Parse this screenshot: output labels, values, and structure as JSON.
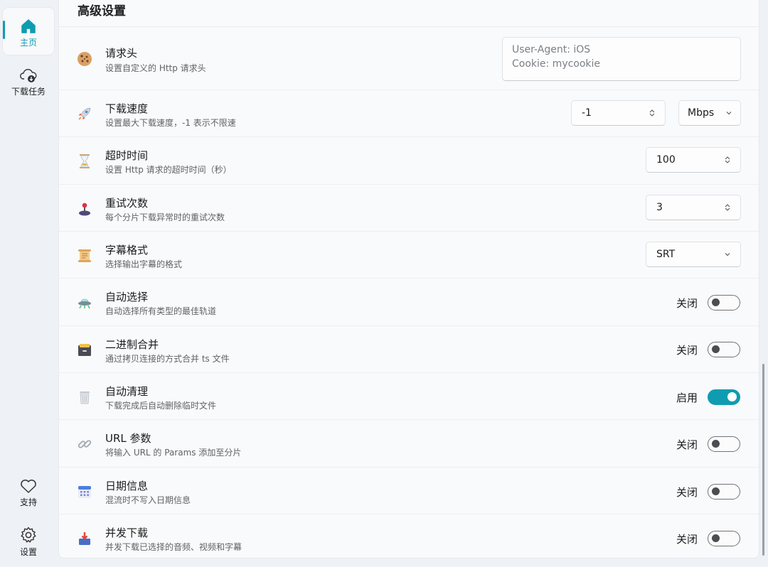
{
  "sidebar": {
    "items": [
      {
        "label": "主页",
        "icon": "home-icon",
        "active": true
      },
      {
        "label": "下载任务",
        "icon": "cloud-download-icon",
        "active": false
      }
    ],
    "bottom_items": [
      {
        "label": "支持",
        "icon": "heart-icon"
      },
      {
        "label": "设置",
        "icon": "gear-icon"
      }
    ]
  },
  "section": {
    "title": "高级设置"
  },
  "rows": {
    "headers": {
      "title": "请求头",
      "desc": "设置自定义的 Http 请求头",
      "icon": "cookie-icon",
      "value_line1": "User-Agent: iOS",
      "value_line2": "Cookie: mycookie"
    },
    "speed": {
      "title": "下载速度",
      "desc": "设置最大下载速度，-1 表示不限速",
      "icon": "rocket-icon",
      "value": "-1",
      "unit": "Mbps"
    },
    "timeout": {
      "title": "超时时间",
      "desc": "设置 Http 请求的超时时间（秒）",
      "icon": "hourglass-icon",
      "value": "100"
    },
    "retry": {
      "title": "重试次数",
      "desc": "每个分片下载异常时的重试次数",
      "icon": "joystick-icon",
      "value": "3"
    },
    "subtitle_format": {
      "title": "字幕格式",
      "desc": "选择输出字幕的格式",
      "icon": "scroll-icon",
      "value": "SRT"
    },
    "auto_select": {
      "title": "自动选择",
      "desc": "自动选择所有类型的最佳轨道",
      "icon": "ufo-icon",
      "state_label": "关闭",
      "on": false
    },
    "binary_merge": {
      "title": "二进制合并",
      "desc": "通过拷贝连接的方式合并 ts 文件",
      "icon": "cabinet-icon",
      "state_label": "关闭",
      "on": false
    },
    "auto_clean": {
      "title": "自动清理",
      "desc": "下载完成后自动删除临时文件",
      "icon": "trash-icon",
      "state_label": "启用",
      "on": true
    },
    "url_params": {
      "title": "URL 参数",
      "desc": "将输入 URL 的 Params 添加至分片",
      "icon": "link-icon",
      "state_label": "关闭",
      "on": false
    },
    "date_info": {
      "title": "日期信息",
      "desc": "混流时不写入日期信息",
      "icon": "calendar-icon",
      "state_label": "关闭",
      "on": false
    },
    "concurrent": {
      "title": "并发下载",
      "desc": "并发下载已选择的音频、视频和字幕",
      "icon": "inbox-download-icon",
      "state_label": "关闭",
      "on": false
    }
  },
  "colors": {
    "accent": "#0f9cb0",
    "toggle_off": "#6f7378"
  }
}
